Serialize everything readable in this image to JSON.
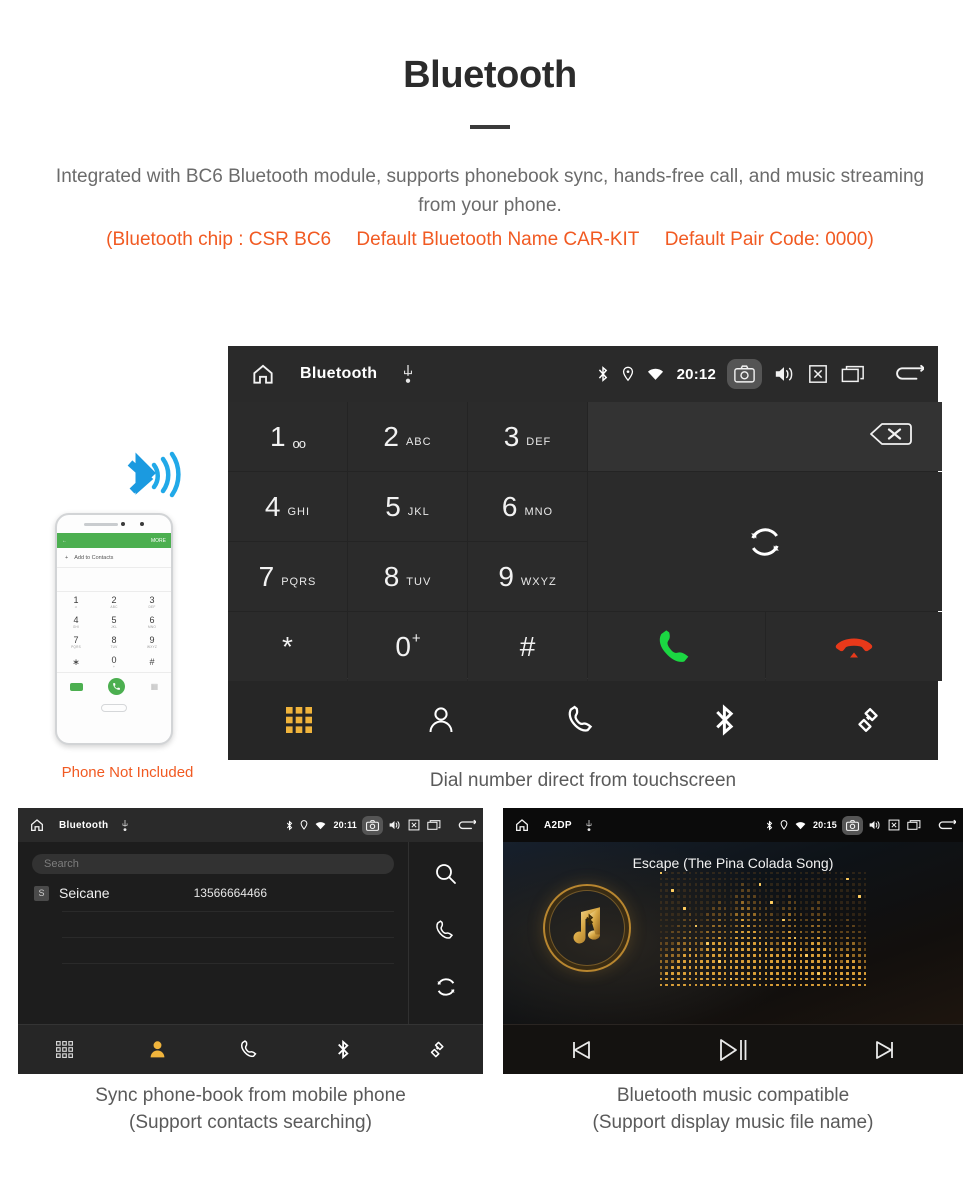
{
  "header": {
    "title": "Bluetooth",
    "description": "Integrated with BC6 Bluetooth module, supports phonebook sync, hands-free call, and music streaming from your phone.",
    "spec_chip": "(Bluetooth chip : CSR BC6",
    "spec_name": "Default Bluetooth Name CAR-KIT",
    "spec_pair": "Default Pair Code: 0000)",
    "accent_color": "#f15a22",
    "text_color": "#6b6b6b"
  },
  "dial_screen": {
    "statusbar": {
      "app_title": "Bluetooth",
      "clock": "20:12",
      "icons": [
        "home-icon",
        "usb-icon",
        "bluetooth-icon",
        "location-icon",
        "wifi-icon",
        "camera-icon",
        "volume-icon",
        "close-box-icon",
        "recents-icon",
        "back-icon"
      ]
    },
    "keys": [
      {
        "digit": "1",
        "sub": "∞",
        "sub_type": "voicemail"
      },
      {
        "digit": "2",
        "sub": "ABC",
        "sub_type": "letters"
      },
      {
        "digit": "3",
        "sub": "DEF",
        "sub_type": "letters"
      },
      {
        "digit": "4",
        "sub": "GHI",
        "sub_type": "letters"
      },
      {
        "digit": "5",
        "sub": "JKL",
        "sub_type": "letters"
      },
      {
        "digit": "6",
        "sub": "MNO",
        "sub_type": "letters"
      },
      {
        "digit": "7",
        "sub": "PQRS",
        "sub_type": "letters"
      },
      {
        "digit": "8",
        "sub": "TUV",
        "sub_type": "letters"
      },
      {
        "digit": "9",
        "sub": "WXYZ",
        "sub_type": "letters"
      },
      {
        "digit": "*",
        "sub": "",
        "sub_type": "none"
      },
      {
        "digit": "0",
        "sub": "+",
        "sub_type": "plus"
      },
      {
        "digit": "#",
        "sub": "",
        "sub_type": "none"
      }
    ],
    "number_display_value": "",
    "actions": {
      "backspace": "backspace-icon",
      "sync": "sync-icon",
      "call": "call-accept-icon",
      "hangup": "call-end-icon"
    },
    "tabs": [
      {
        "name": "dialpad",
        "icon": "dialpad-icon",
        "active": true
      },
      {
        "name": "contacts",
        "icon": "person-icon",
        "active": false
      },
      {
        "name": "call-log",
        "icon": "phone-icon",
        "active": false
      },
      {
        "name": "bluetooth",
        "icon": "bluetooth-icon",
        "active": false
      },
      {
        "name": "pair-link",
        "icon": "link-icon",
        "active": false
      }
    ],
    "active_tab_color": "#f0b43c",
    "caption": "Dial number direct from touchscreen"
  },
  "phone_mockup": {
    "header_back": "←",
    "header_more": "MORE",
    "add_contacts": "Add to Contacts",
    "keys": [
      {
        "digit": "1",
        "sub": "∞"
      },
      {
        "digit": "2",
        "sub": "ABC"
      },
      {
        "digit": "3",
        "sub": "DEF"
      },
      {
        "digit": "4",
        "sub": "GHI"
      },
      {
        "digit": "5",
        "sub": "JKL"
      },
      {
        "digit": "6",
        "sub": "MNO"
      },
      {
        "digit": "7",
        "sub": "PQRS"
      },
      {
        "digit": "8",
        "sub": "TUV"
      },
      {
        "digit": "9",
        "sub": "WXYZ"
      },
      {
        "digit": "∗",
        "sub": ""
      },
      {
        "digit": "0",
        "sub": "+"
      },
      {
        "digit": "#",
        "sub": ""
      }
    ],
    "not_included_note": "Phone Not Included",
    "note_color": "#f15a22"
  },
  "phonebook_screen": {
    "statusbar": {
      "app_title": "Bluetooth",
      "clock": "20:11"
    },
    "search_placeholder": "Search",
    "contacts": [
      {
        "initial": "S",
        "name": "Seicane",
        "number": "13566664466"
      }
    ],
    "side_actions": [
      "search-icon",
      "phone-icon",
      "sync-icon"
    ],
    "tabs": [
      {
        "name": "dialpad",
        "icon": "dialpad-icon",
        "active": false
      },
      {
        "name": "contacts",
        "icon": "person-icon",
        "active": true
      },
      {
        "name": "call-log",
        "icon": "phone-icon",
        "active": false
      },
      {
        "name": "bluetooth",
        "icon": "bluetooth-icon",
        "active": false
      },
      {
        "name": "pair-link",
        "icon": "link-icon",
        "active": false
      }
    ],
    "caption_line1": "Sync phone-book from mobile phone",
    "caption_line2": "(Support contacts searching)"
  },
  "music_screen": {
    "statusbar": {
      "app_title": "A2DP",
      "clock": "20:15"
    },
    "track_title": "Escape (The Pina Colada Song)",
    "album_icon": "music-note-bluetooth-icon",
    "controls": [
      {
        "name": "previous",
        "icon": "skip-previous-icon"
      },
      {
        "name": "play-pause",
        "icon": "play-pause-icon"
      },
      {
        "name": "next",
        "icon": "skip-next-icon"
      }
    ],
    "caption_line1": "Bluetooth music compatible",
    "caption_line2": "(Support display music file name)"
  }
}
